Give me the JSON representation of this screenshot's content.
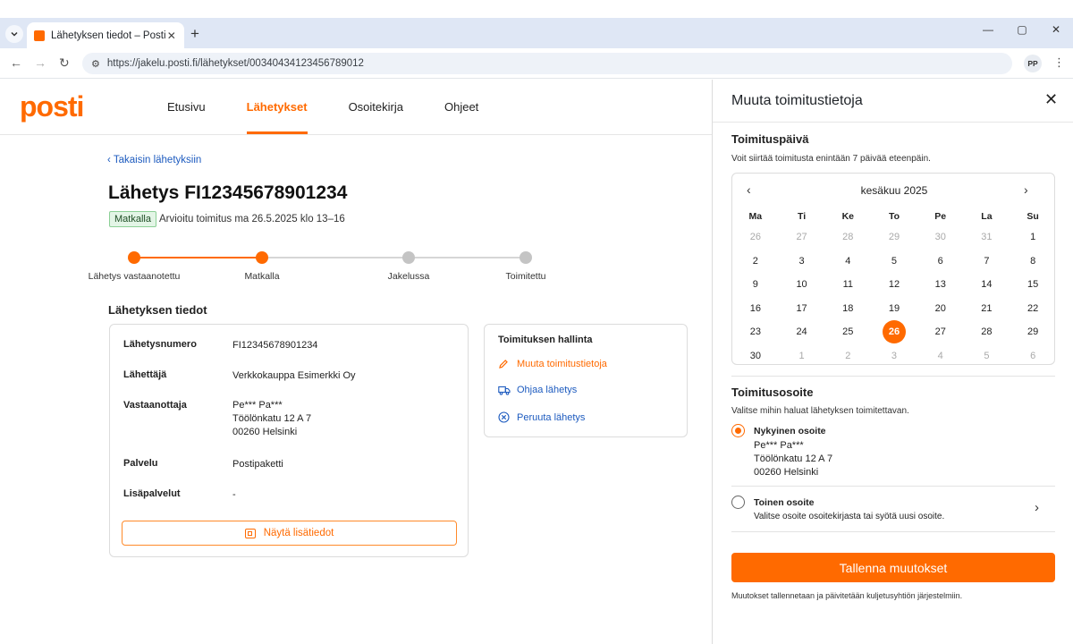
{
  "browser": {
    "tab_title": "Lähetyksen tiedot – Posti",
    "url": "https://jakelu.posti.fi/lähetykset/00340434123456789012",
    "profile_initials": "PP"
  },
  "site": {
    "logo": "posti",
    "nav": [
      {
        "label": "Etusivu",
        "active": false
      },
      {
        "label": "Lähetykset",
        "active": true
      },
      {
        "label": "Osoitekirja",
        "active": false
      },
      {
        "label": "Ohjeet",
        "active": false
      }
    ]
  },
  "shipment": {
    "back_link": "Takaisin lähetyksiin",
    "title": "Lähetys FI12345678901234",
    "status": "Matkalla",
    "eta": "Arvioitu toimitus ma 26.5.2025 klo 13–16",
    "steps": [
      {
        "label": "Lähetys vastaanotettu",
        "state": "done"
      },
      {
        "label": "Matkalla",
        "state": "done"
      },
      {
        "label": "Jakelussa",
        "state": "pending"
      },
      {
        "label": "Toimitettu",
        "state": "pending"
      }
    ],
    "details_title": "Lähetyksen tiedot",
    "details": {
      "number_label": "Lähetysnumero",
      "number": "FI12345678901234",
      "sender_label": "Lähettäjä",
      "sender": "Verkkokauppa Esimerkki Oy",
      "recipient_label": "Vastaanottaja",
      "recipient_name": "Pe*** Pa***",
      "recipient_street": "Töölönkatu 12 A 7",
      "recipient_city": "00260 Helsinki",
      "service_label": "Palvelu",
      "service": "Postipaketti",
      "extras_label": "Lisäpalvelut",
      "extras": "-"
    },
    "more_button": "Näytä lisätiedot"
  },
  "manage": {
    "title": "Toimituksen hallinta",
    "edit": "Muuta toimitustietoja",
    "redirect": "Ohjaa lähetys",
    "cancel": "Peruuta lähetys"
  },
  "panel": {
    "title": "Muuta toimitustietoja",
    "date_title": "Toimituspäivä",
    "date_hint": "Voit siirtää toimitusta enintään 7 päivää eteenpäin.",
    "month": "kesäkuu 2025",
    "weekdays": [
      "Ma",
      "Ti",
      "Ke",
      "To",
      "Pe",
      "La",
      "Su"
    ],
    "days": [
      {
        "d": "26",
        "muted": true
      },
      {
        "d": "27",
        "muted": true
      },
      {
        "d": "28",
        "muted": true
      },
      {
        "d": "29",
        "muted": true
      },
      {
        "d": "30",
        "muted": true
      },
      {
        "d": "31",
        "muted": true
      },
      {
        "d": "1",
        "muted": false
      },
      {
        "d": "2",
        "muted": false
      },
      {
        "d": "3",
        "muted": false
      },
      {
        "d": "4",
        "muted": false
      },
      {
        "d": "5",
        "muted": false
      },
      {
        "d": "6",
        "muted": false
      },
      {
        "d": "7",
        "muted": false
      },
      {
        "d": "8",
        "muted": false
      },
      {
        "d": "9",
        "muted": false
      },
      {
        "d": "10",
        "muted": false
      },
      {
        "d": "11",
        "muted": false
      },
      {
        "d": "12",
        "muted": false
      },
      {
        "d": "13",
        "muted": false
      },
      {
        "d": "14",
        "muted": false
      },
      {
        "d": "15",
        "muted": false
      },
      {
        "d": "16",
        "muted": false
      },
      {
        "d": "17",
        "muted": false
      },
      {
        "d": "18",
        "muted": false
      },
      {
        "d": "19",
        "muted": false
      },
      {
        "d": "20",
        "muted": false
      },
      {
        "d": "21",
        "muted": false
      },
      {
        "d": "22",
        "muted": false
      },
      {
        "d": "23",
        "muted": false
      },
      {
        "d": "24",
        "muted": false
      },
      {
        "d": "25",
        "muted": false
      },
      {
        "d": "26",
        "muted": false,
        "selected": true
      },
      {
        "d": "27",
        "muted": false
      },
      {
        "d": "28",
        "muted": false
      },
      {
        "d": "29",
        "muted": false
      },
      {
        "d": "30",
        "muted": false
      },
      {
        "d": "1",
        "muted": true
      },
      {
        "d": "2",
        "muted": true
      },
      {
        "d": "3",
        "muted": true
      },
      {
        "d": "4",
        "muted": true
      },
      {
        "d": "5",
        "muted": true
      },
      {
        "d": "6",
        "muted": true
      }
    ],
    "address_title": "Toimitusosoite",
    "address_hint": "Valitse mihin haluat lähetyksen toimitettavan.",
    "current_title": "Nykyinen osoite",
    "current_name": "Pe*** Pa***",
    "current_street": "Töölönkatu 12 A 7",
    "current_city": "00260 Helsinki",
    "other_title": "Toinen osoite",
    "other_text": "Valitse osoite osoitekirjasta tai syötä uusi osoite.",
    "save": "Tallenna muutokset",
    "footnote": "Muutokset tallennetaan ja päivitetään kuljetusyhtiön järjestelmiin."
  },
  "colors": {
    "accent": "#ff6a00",
    "link": "#1d5bbf",
    "pending": "#c4c4c4"
  }
}
